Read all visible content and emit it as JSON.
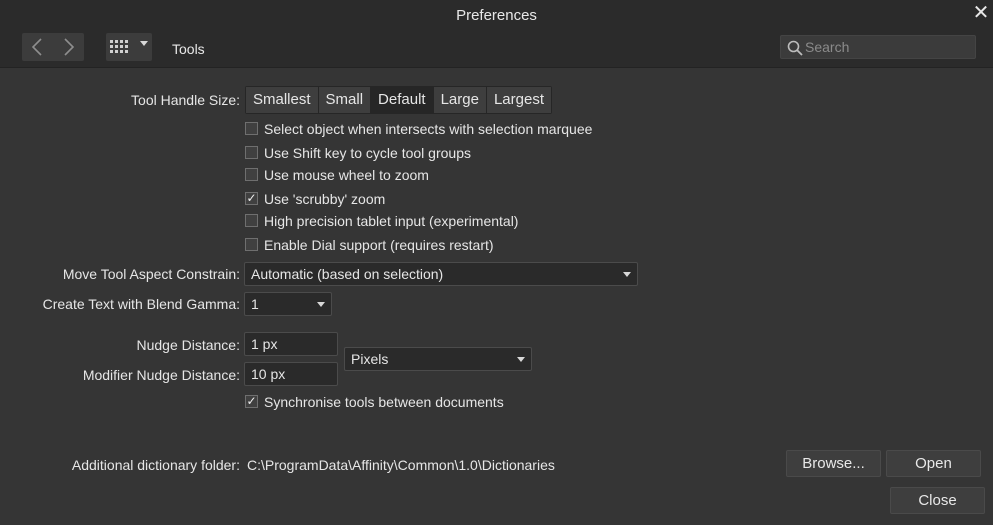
{
  "window": {
    "title": "Preferences"
  },
  "toolbar": {
    "section": "Tools",
    "search_placeholder": "Search"
  },
  "tool_handle_size": {
    "label": "Tool Handle Size:",
    "options": [
      "Smallest",
      "Small",
      "Default",
      "Large",
      "Largest"
    ],
    "selected": "Default"
  },
  "checkboxes": [
    {
      "label": "Select object when intersects with selection marquee",
      "checked": false
    },
    {
      "label": "Use Shift key to cycle tool groups",
      "checked": false
    },
    {
      "label": "Use mouse wheel to zoom",
      "checked": false
    },
    {
      "label": "Use 'scrubby' zoom",
      "checked": true
    },
    {
      "label": "High precision tablet input (experimental)",
      "checked": false
    },
    {
      "label": "Enable Dial support (requires restart)",
      "checked": false
    }
  ],
  "move_tool": {
    "label": "Move Tool Aspect Constrain:",
    "value": "Automatic (based on selection)"
  },
  "blend_gamma": {
    "label": "Create Text with Blend Gamma:",
    "value": "1"
  },
  "nudge": {
    "label": "Nudge Distance:",
    "value": "1 px",
    "modifier_label": "Modifier Nudge Distance:",
    "modifier_value": "10 px",
    "unit": "Pixels"
  },
  "sync": {
    "label": "Synchronise tools between documents",
    "checked": true
  },
  "dictionary": {
    "label": "Additional dictionary folder:",
    "path": "C:\\ProgramData\\Affinity\\Common\\1.0\\Dictionaries",
    "browse": "Browse...",
    "open": "Open"
  },
  "footer": {
    "close": "Close"
  },
  "icons": {
    "close": "close-icon",
    "back": "chevron-left-icon",
    "forward": "chevron-right-icon",
    "grid": "grid-icon",
    "search": "search-icon",
    "check": "checkmark-icon"
  }
}
